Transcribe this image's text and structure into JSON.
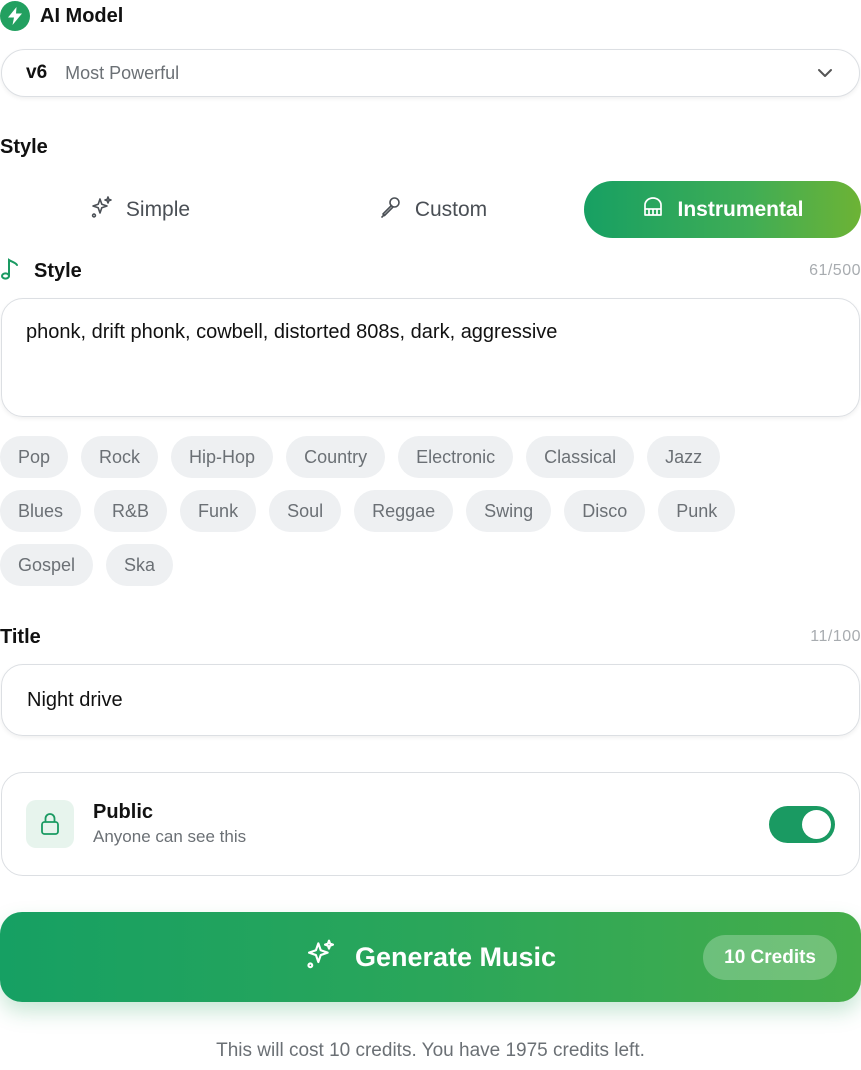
{
  "ai_model": {
    "label": "AI Model",
    "icon": "bolt-icon",
    "selected_version": "v6",
    "selected_description": "Most Powerful"
  },
  "style_section": {
    "label": "Style",
    "tabs": [
      {
        "label": "Simple",
        "icon": "sparkles-icon",
        "active": false
      },
      {
        "label": "Custom",
        "icon": "pen-icon",
        "active": false
      },
      {
        "label": "Instrumental",
        "icon": "piano-icon",
        "active": true
      }
    ]
  },
  "style_field": {
    "label": "Style",
    "icon": "music-note-icon",
    "counter": "61/500",
    "value": "phonk, drift phonk, cowbell, distorted 808s, dark, aggressive"
  },
  "genres": [
    [
      "Pop",
      "Rock",
      "Hip-Hop",
      "Country",
      "Electronic",
      "Classical",
      "Jazz"
    ],
    [
      "Blues",
      "R&B",
      "Funk",
      "Soul",
      "Reggae",
      "Swing",
      "Disco",
      "Punk"
    ],
    [
      "Gospel",
      "Ska"
    ]
  ],
  "title_field": {
    "label": "Title",
    "counter": "11/100",
    "value": "Night drive"
  },
  "visibility": {
    "title": "Public",
    "subtitle": "Anyone can see this",
    "enabled": true
  },
  "generate": {
    "label": "Generate Music",
    "credits_badge": "10 Credits"
  },
  "footnote": "This will cost 10 credits. You have 1975 credits left.",
  "colors": {
    "accent": "#1a9a62",
    "accent_light": "#6db335",
    "chip_bg": "#eef0f2",
    "muted_text": "#6b7075"
  }
}
